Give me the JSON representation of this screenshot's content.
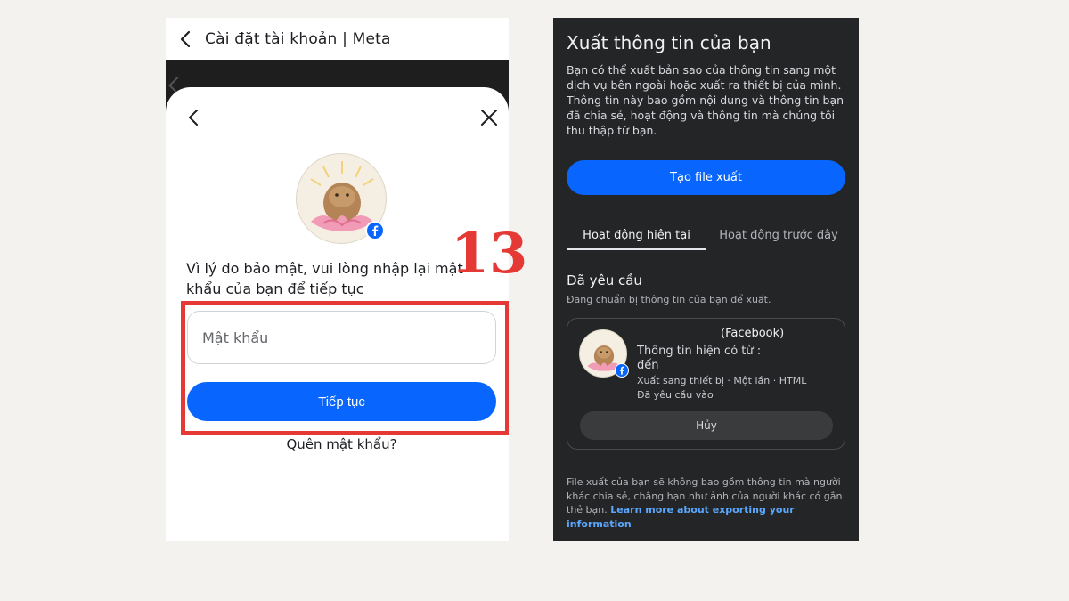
{
  "left": {
    "header_title": "Cài đặt tài khoản | Meta",
    "prompt": "Vì lý do bảo mật, vui lòng nhập lại mật khẩu của bạn để tiếp tục",
    "password_placeholder": "Mật khẩu",
    "continue_label": "Tiếp tục",
    "forgot_label": "Quên mật khẩu?"
  },
  "step_number": "13",
  "right": {
    "title": "Xuất thông tin của bạn",
    "description": "Bạn có thể xuất bản sao của thông tin sang một dịch vụ bên ngoài hoặc xuất ra thiết bị của mình. Thông tin này bao gồm nội dung và thông tin bạn đã chia sẻ, hoạt động và thông tin mà chúng tôi thu thập từ bạn.",
    "create_label": "Tạo file xuất",
    "tabs": [
      {
        "label": "Hoạt động hiện tại"
      },
      {
        "label": "Hoạt động trước đây"
      }
    ],
    "section_title": "Đã yêu cầu",
    "section_subtitle": "Đang chuẩn bị thông tin của bạn để xuất.",
    "card": {
      "name": "(Facebook)",
      "availability": "Thông tin hiện có từ : đến",
      "meta": "Xuất sang thiết bị · Một lần · HTML",
      "requested": "Đã yêu cầu vào",
      "cancel_label": "Hủy"
    },
    "footer_text": "File xuất của bạn sẽ không bao gồm thông tin mà người khác chia sẻ, chẳng hạn như ảnh của người khác có gắn thẻ bạn.",
    "footer_link": "Learn more about exporting your information"
  },
  "colors": {
    "accent_blue": "#0866ff",
    "highlight_red": "#e53935",
    "dark_bg": "#242526"
  }
}
